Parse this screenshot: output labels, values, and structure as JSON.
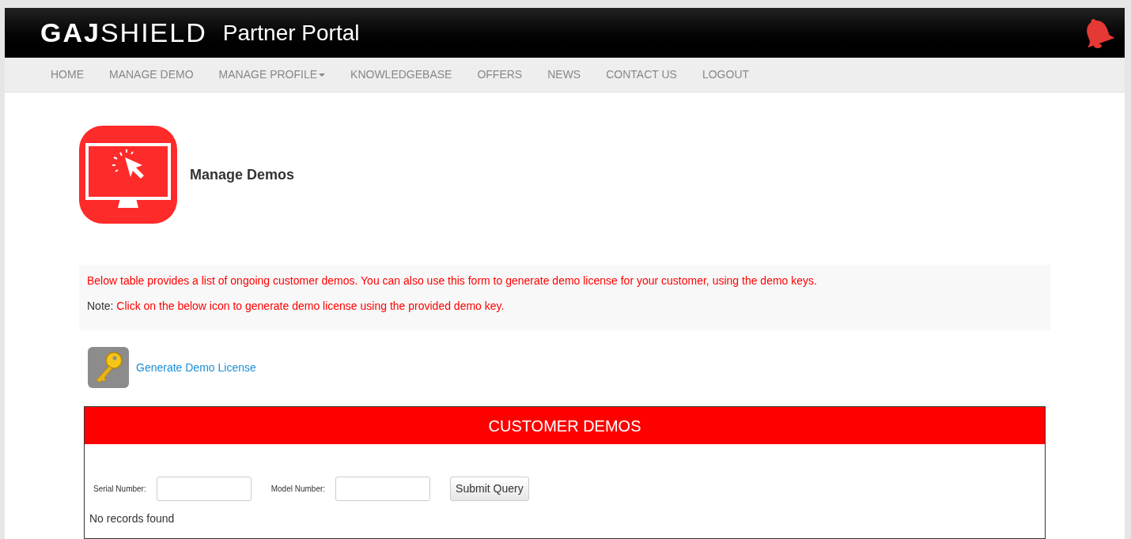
{
  "header": {
    "logo": "**GAJ**SHIELD",
    "title": "Partner Portal"
  },
  "nav": [
    {
      "label": "HOME",
      "has_menu": false
    },
    {
      "label": "MANAGE DEMO",
      "has_menu": false
    },
    {
      "label": "MANAGE PROFILE",
      "has_menu": true
    },
    {
      "label": "KNOWLEDGEBASE",
      "has_menu": false
    },
    {
      "label": "OFFERS",
      "has_menu": false
    },
    {
      "label": "NEWS",
      "has_menu": false
    },
    {
      "label": "CONTACT US",
      "has_menu": false
    },
    {
      "label": "LOGOUT",
      "has_menu": false
    }
  ],
  "page_title": "Manage Demos",
  "info": {
    "line": "Below table provides a list of ongoing customer demos. You can also use this form to generate demo license for your customer, using the demo keys.",
    "note_label": "Note:",
    "note": "Click on the below icon to generate demo license using the provided demo key."
  },
  "generate_link": "Generate Demo License",
  "panel": {
    "title": "CUSTOMER DEMOS",
    "fields": [
      {
        "label": "Serial Number:"
      },
      {
        "label": "Model Number:"
      }
    ],
    "submit": "Submit Query",
    "empty": "No records found"
  }
}
